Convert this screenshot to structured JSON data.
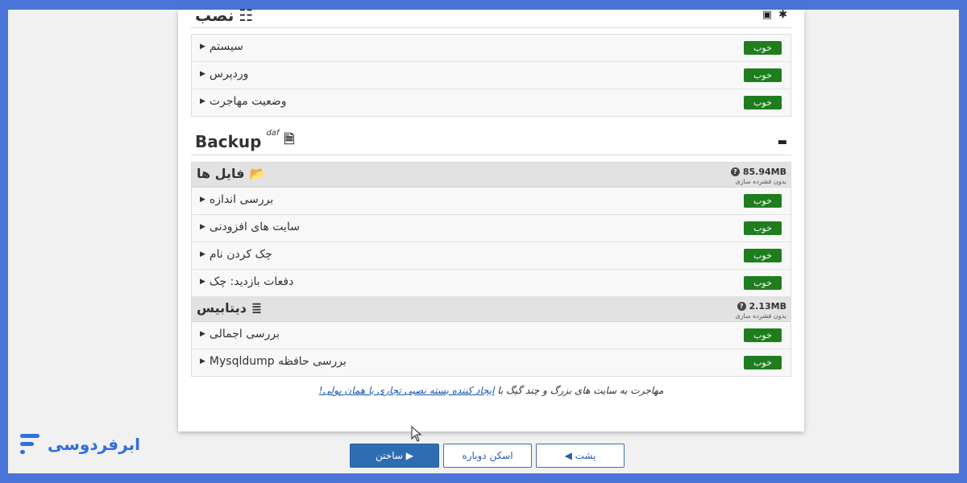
{
  "install": {
    "title": "نصب",
    "rows": [
      {
        "label": "سیستم",
        "status": "خوب"
      },
      {
        "label": "وردپرس",
        "status": "خوب"
      },
      {
        "label": "وضعیت مهاجرت",
        "status": "خوب"
      }
    ]
  },
  "backup": {
    "title": "Backup",
    "title_sup": "daf",
    "files": {
      "title": "فایل ها",
      "size": "85.94MB",
      "size_note": "بدون فشرده سازی",
      "rows": [
        {
          "label": "بررسی اندازه",
          "status": "خوب"
        },
        {
          "label": "سایت های افزودنی",
          "status": "خوب"
        },
        {
          "label": "چک کردن نام",
          "status": "خوب"
        },
        {
          "label": "دفعات بازدید: چک",
          "status": "خوب"
        }
      ]
    },
    "database": {
      "title": "دیتابیس",
      "size": "2.13MB",
      "size_note": "بدون فشرده سازی",
      "rows": [
        {
          "label": "بررسی اجمالی",
          "status": "خوب"
        },
        {
          "label": "بررسی حافظه Mysqldump",
          "status": "خوب"
        }
      ]
    }
  },
  "footnote": {
    "text": "مهاجرت به سایت های بزرگ و چند گیگ با",
    "link": "ایجاد کننده بسته نصبی تجاری با همان پولی!"
  },
  "buttons": {
    "back": "◀ پشت",
    "rescan": "اسکن دوباره",
    "build": "ساختن ▶"
  },
  "brand": {
    "name": "ابرفردوسی",
    "color": "#2f6fe0"
  },
  "colors": {
    "good": "#1e7e1e",
    "primary": "#2f6db3"
  }
}
